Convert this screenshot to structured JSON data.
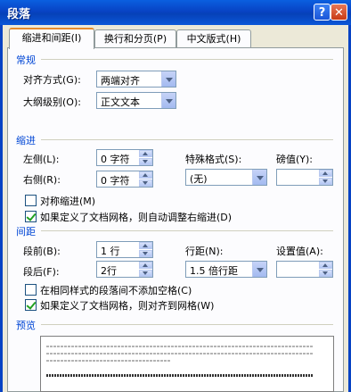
{
  "window": {
    "title": "段落"
  },
  "tabs": [
    {
      "label": "缩进和间距(I)"
    },
    {
      "label": "换行和分页(P)"
    },
    {
      "label": "中文版式(H)"
    }
  ],
  "general": {
    "section": "常规",
    "alignment_label": "对齐方式(G):",
    "alignment_value": "两端对齐",
    "outline_label": "大纲级别(O):",
    "outline_value": "正文文本"
  },
  "indent": {
    "section": "缩进",
    "left_label": "左侧(L):",
    "left_value": "0 字符",
    "right_label": "右侧(R):",
    "right_value": "0 字符",
    "special_label": "特殊格式(S):",
    "special_value": "(无)",
    "by_label": "磅值(Y):",
    "by_value": "",
    "mirror_label": "对称缩进(M)",
    "mirror_checked": false,
    "auto_right_label": "如果定义了文档网格，则自动调整右缩进(D)",
    "auto_right_checked": true
  },
  "spacing": {
    "section": "间距",
    "before_label": "段前(B):",
    "before_value": "1 行",
    "after_label": "段后(F):",
    "after_value": "2行",
    "line_label": "行距(N):",
    "line_value": "1.5 倍行距",
    "at_label": "设置值(A):",
    "at_value": "",
    "no_space_label": "在相同样式的段落间不添加空格(C)",
    "no_space_checked": false,
    "snap_grid_label": "如果定义了文档网格，则对齐到网格(W)",
    "snap_grid_checked": true
  },
  "preview": {
    "section": "预览"
  }
}
